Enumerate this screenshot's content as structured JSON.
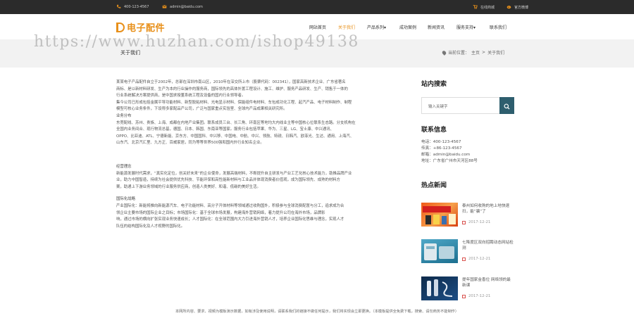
{
  "topbar": {
    "phone": "400-123-4567",
    "email": "admin@baidu.com",
    "shop": "在线商城",
    "weibo": "官方微博"
  },
  "logo": {
    "text": "电子配件"
  },
  "nav": [
    "网站首页",
    "关于我们",
    "产品系列",
    "成功案例",
    "新闻资讯",
    "服务支持",
    "联系我们"
  ],
  "nav_active": 1,
  "watermark": "https://www.huzhan.com/ishop49138",
  "banner": {
    "title": "关于我们",
    "crumb_label": "当前位置：",
    "crumb_home": "主页",
    "crumb_sep": ">",
    "crumb_current": "关于我们"
  },
  "about": {
    "intro_1": "某某电子产品配件自立于2002年，总部在深圳市南山区，2010年在深交所上市（股票代码：002341），国家高新技术企业、广东省著名",
    "intro_2": "商标、是以新材料研发、生产为本的行业操作的服务商，国际领先的高体外置工程设计、施工、维护、服务产品研发、生产、销售于一体的",
    "intro_3": "行业系统解决方案提供商，是中国求授董系统工程及设备的国内行业领导者。",
    "intro_4": "集今公司已形成包括金属平导功能材料、新型胶粘材料、光电显示材料、保能组件电材料、车包成功化工程、起汽产品、电子材料制作、制程",
    "intro_5": "模型可核心业务条件，下设称多家配品产公司，广泛与国家重点实验室、全球内产品成果相关研究所。",
    "clients_title": "业务分布",
    "clients_1": "东莞配线、苏州、贵族、上海、成都在内地产业集团。联系成员三台、长三角、环南区等地均大内线业主等中国核心位联系生态路。分支机构在",
    "clients_2": "全国内业务间合、现行物流总基，德国、日本、韩国、东南亚等国家。服务行业包括苹果、华为、三星、LG、宝士康、中兴通讯、",
    "clients_3": "OPPO、比亚迪、ATL、宁德新能、京东方、中国国科、中兴移、中国电、中航、中兴、领航、特锐、日韩汽、欧菲光、生达、通用、上海汽、",
    "clients_4": "山东汽、北京汽汇里、九方正、百威家居，同为等等世界500强和国内外行业知名企业。",
    "mission_title": "经营理念",
    "mission_1": "新能源发展时代需求，“真实化定位，创关好未来”的企业使命，发展高端材料，不断提升自主研发与产业工艺化核心技术能力，助推品牌产业",
    "mission_2": "业，助力中国智造，持续为社会提供优先科技、节能环保和高性能新材料与工业品并体现消费者价值观，成为国际领先、成熟的材料方",
    "mission_3": "案，助通上下游业务领域的行业服务供应商，创造人类美好、和谐、低碳的美好生活。",
    "intl_title": "国际化战略",
    "intl_1": "产业国际化：新能将推向新能源汽车、电子功能材料、高分子开体材料等领域通过收购国外，积极参与全球消费配置与分工，追求成为合",
    "intl_2": "领企业主要市场的国际企业之目标；市场国际化：基于全球市场发展，构建海外营销网络，着力提升公司在海外市场，品牌影",
    "intl_3": "响，通过市场的横向扩张实现业务快速成长；人才国际化：在全球范围内大力引进海外营销人才，培养企业国际化思维与理念，实现人才",
    "intl_4": "队伍的结构国际化及人才视野的国际化。"
  },
  "sidebar": {
    "search_title": "站内搜索",
    "search_placeholder": "输入关键字",
    "contact_title": "联系信息",
    "contact": {
      "phone": "电话：400-123-4567",
      "fax": "传真：+86-123-4567",
      "email": "邮箱：admin@baidu.com",
      "address": "地址：广东省广州市天河区88号"
    },
    "news_title": "热点新闻",
    "news": [
      {
        "title": "泰州如何收购的地上地快速扫，能“骗”了",
        "date": "2017-12-21",
        "thumb_text": "手机配件/电子配件"
      },
      {
        "title": "七降度区双向招聘动态网站检测",
        "date": "2017-12-21",
        "thumb_text": ""
      },
      {
        "title": "提年国家金香位 网络领的最新课",
        "date": "2017-12-21",
        "thumb_text": ""
      }
    ]
  },
  "footer": "本网所内容、要求、视频为模板演示数据，如有涉及使用说明，请联系我们的链接不做任何提示，我们将实现会立即更换。（本模板提供全免费下载，搜索、请勿商务不能制作）",
  "colors": {
    "accent": "#e8901a",
    "topbar": "#2b2b2b",
    "search_btn": "#2e5e6e",
    "banner": "#f2f2f2"
  }
}
